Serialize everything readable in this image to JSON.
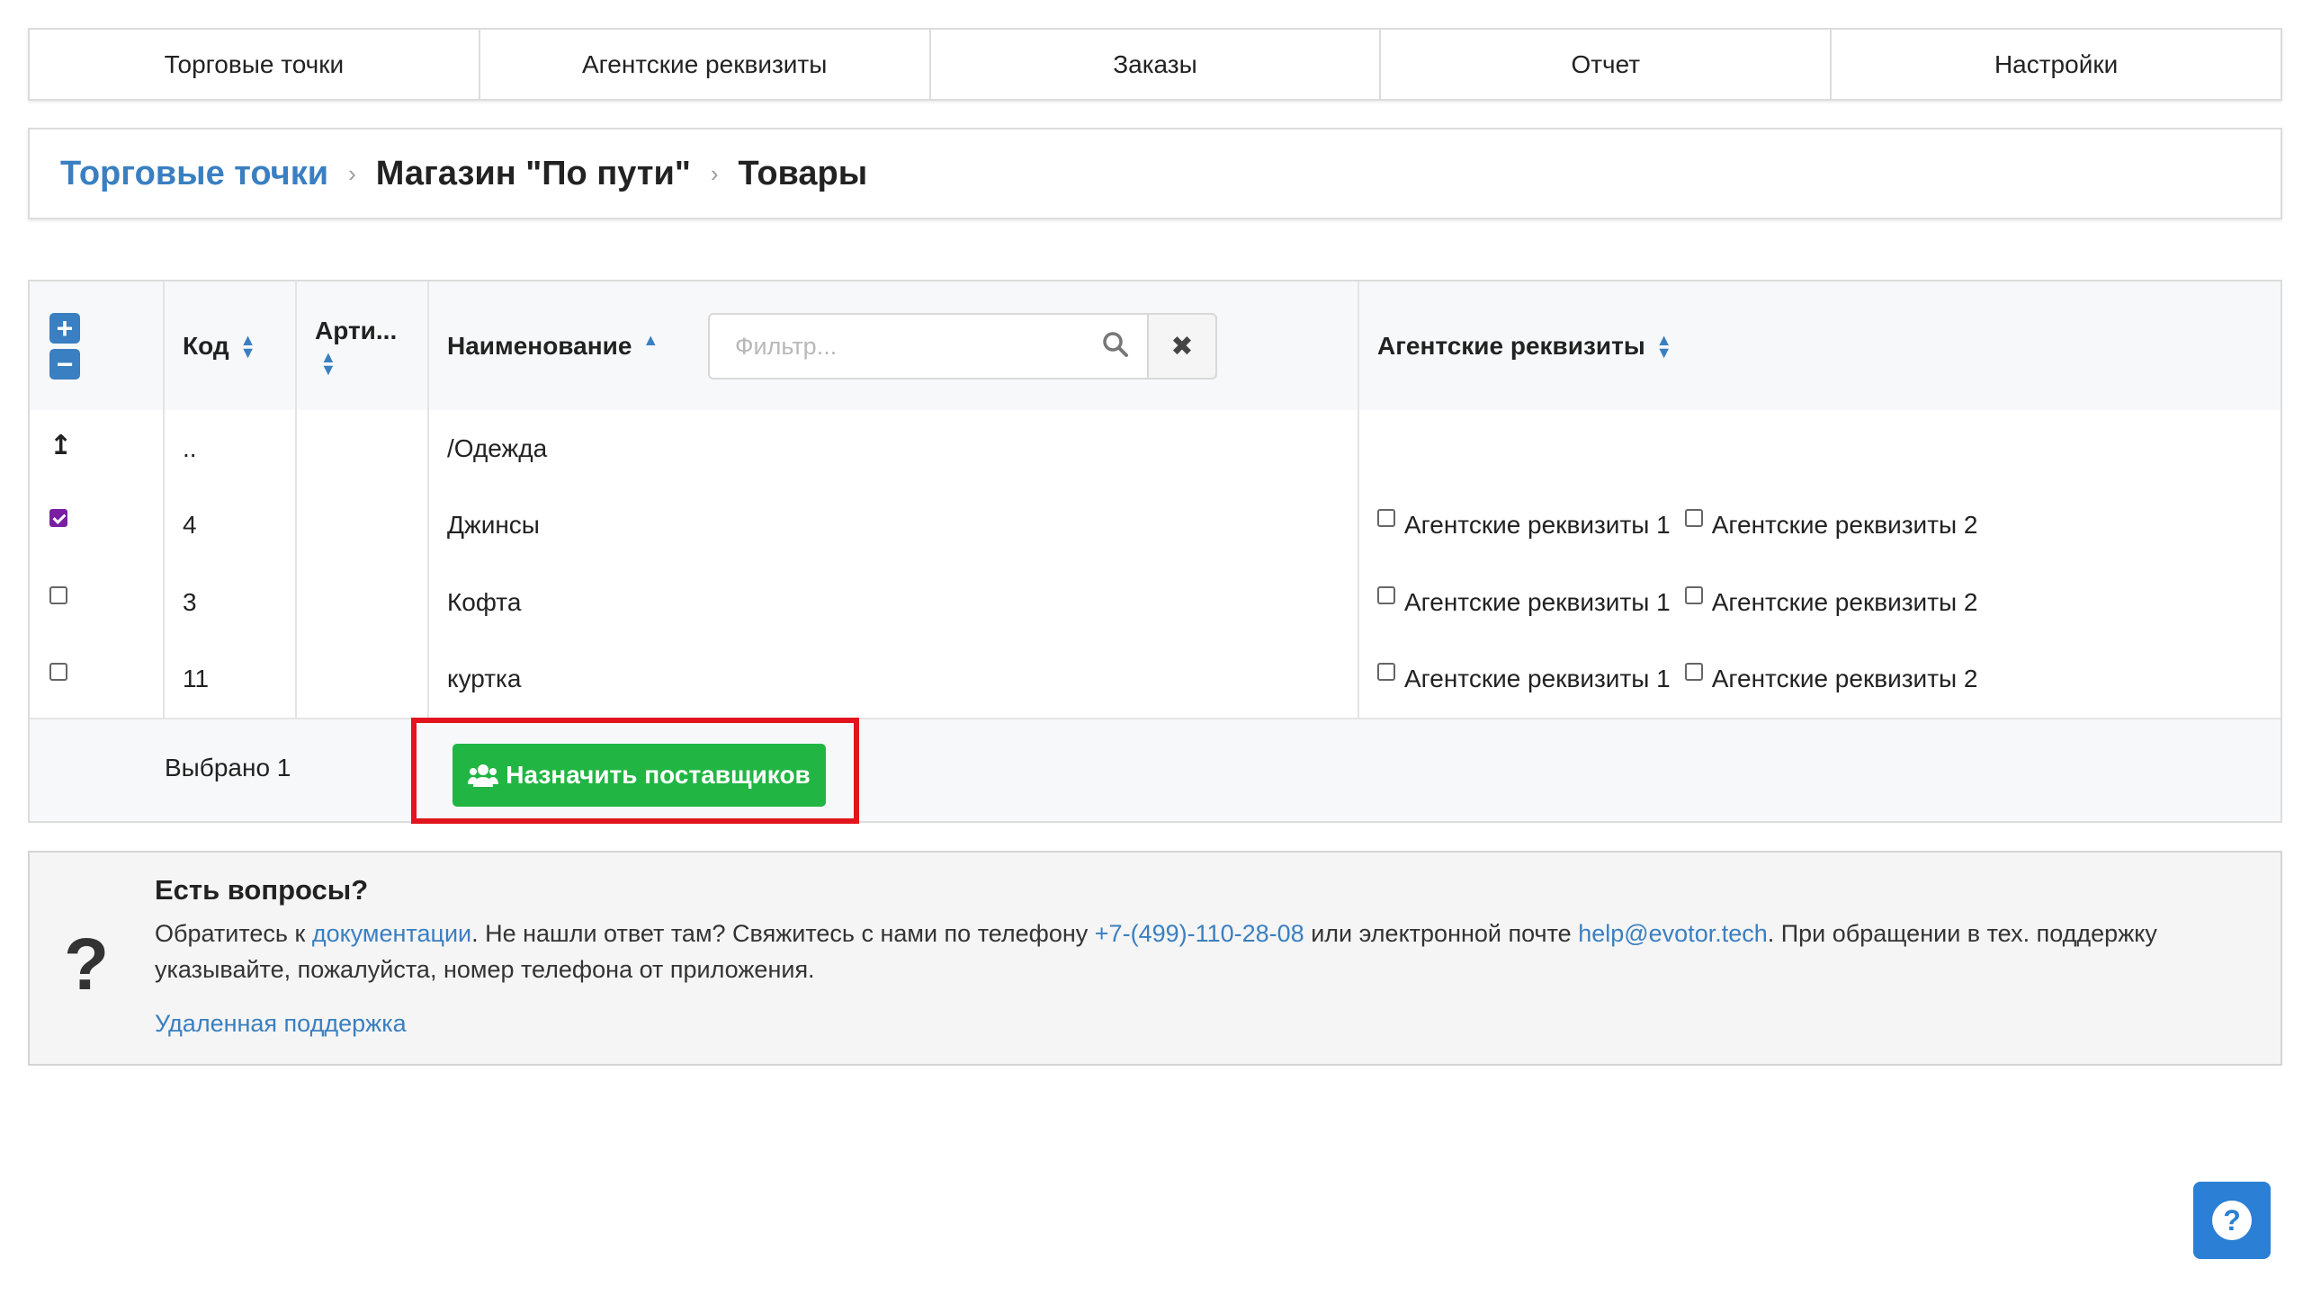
{
  "nav": {
    "items": [
      {
        "label": "Торговые точки"
      },
      {
        "label": "Агентские реквизиты"
      },
      {
        "label": "Заказы"
      },
      {
        "label": "Отчет"
      },
      {
        "label": "Настройки"
      }
    ]
  },
  "breadcrumb": {
    "root": "Торговые точки",
    "store": "Магазин \"По пути\"",
    "current": "Товары",
    "separator": "›"
  },
  "table": {
    "headers": {
      "code": "Код",
      "article": "Арти...",
      "name": "Наименование",
      "agent": "Агентские реквизиты"
    },
    "filter_placeholder": "Фильтр...",
    "clear_symbol": "✖",
    "up_row": {
      "code": "..",
      "name": "/Одежда"
    },
    "rows": [
      {
        "checked": true,
        "code": "4",
        "article": "",
        "name": "Джинсы",
        "agent1": "Агентские реквизиты 1",
        "agent2": "Агентские реквизиты 2"
      },
      {
        "checked": false,
        "code": "3",
        "article": "",
        "name": "Кофта",
        "agent1": "Агентские реквизиты 1",
        "agent2": "Агентские реквизиты 2"
      },
      {
        "checked": false,
        "code": "11",
        "article": "",
        "name": "куртка",
        "agent1": "Агентские реквизиты 1",
        "agent2": "Агентские реквизиты 2"
      }
    ],
    "selected_text": "Выбрано 1",
    "assign_button": "Назначить поставщиков"
  },
  "help": {
    "title": "Есть вопросы?",
    "text_1": "Обратитесь к ",
    "doc_link": "документации",
    "text_2": ". Не нашли ответ там? Свяжитесь с нами по телефону ",
    "phone": "+7-(499)-110-28-08",
    "text_3": " или электронной почте ",
    "email": "help@evotor.tech",
    "text_4": ". При обращении в тех. поддержку указывайте, пожалуйста, номер телефона от приложения.",
    "remote": "Удаленная поддержка"
  },
  "colors": {
    "accent": "#3a7fc1",
    "button_green": "#21b543",
    "highlight_red": "#e2141e",
    "checkbox_purple": "#7a1fa2"
  }
}
